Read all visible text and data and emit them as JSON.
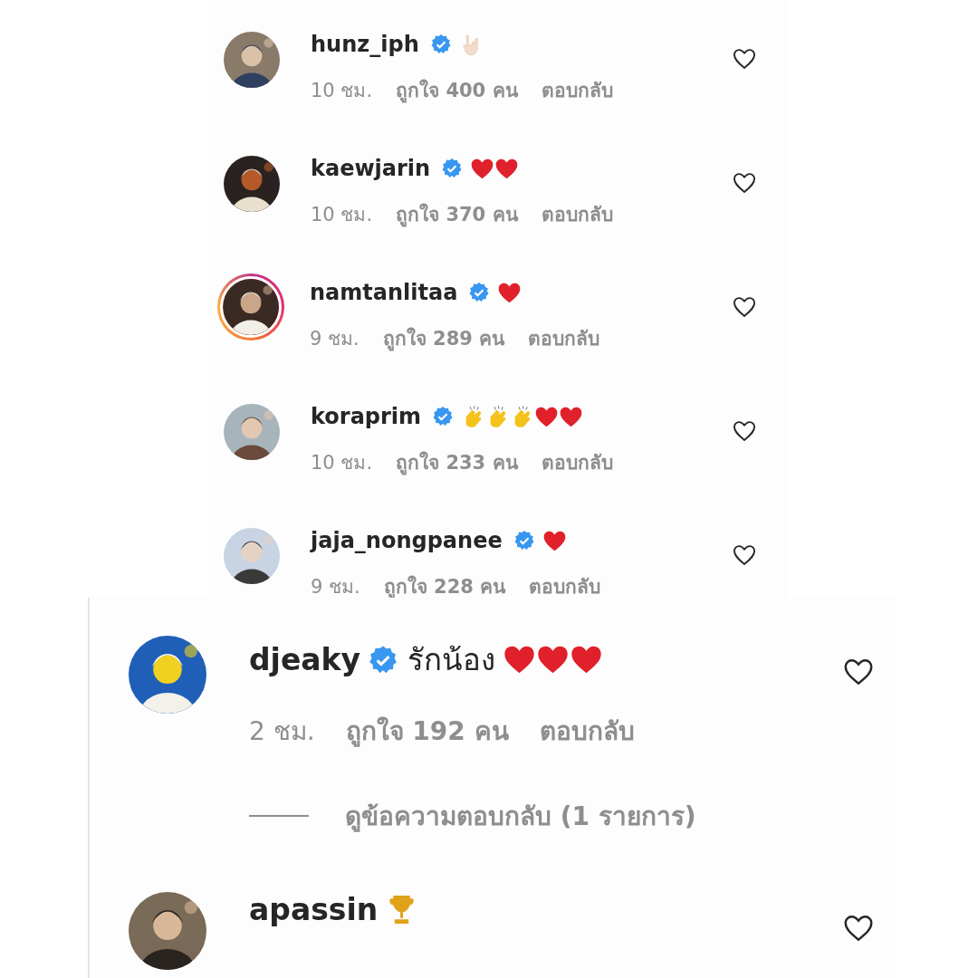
{
  "panels": [
    {
      "comments": [
        {
          "username": "hunz_iph",
          "verified": true,
          "story": false,
          "reactions": [
            {
              "kind": "horns"
            }
          ],
          "time": "10 ชม.",
          "likes": "ถูกใจ 400 คน",
          "reply": "ตอบกลับ"
        },
        {
          "username": "kaewjarin",
          "verified": true,
          "story": false,
          "reactions": [
            {
              "kind": "heart"
            },
            {
              "kind": "heart"
            }
          ],
          "time": "10 ชม.",
          "likes": "ถูกใจ 370 คน",
          "reply": "ตอบกลับ"
        },
        {
          "username": "namtanlitaa",
          "verified": true,
          "story": true,
          "reactions": [
            {
              "kind": "heart"
            }
          ],
          "time": "9 ชม.",
          "likes": "ถูกใจ 289 คน",
          "reply": "ตอบกลับ"
        },
        {
          "username": "koraprim",
          "verified": true,
          "story": false,
          "reactions": [
            {
              "kind": "clap"
            },
            {
              "kind": "clap"
            },
            {
              "kind": "clap"
            },
            {
              "kind": "heart"
            },
            {
              "kind": "heart"
            }
          ],
          "time": "10 ชม.",
          "likes": "ถูกใจ 233 คน",
          "reply": "ตอบกลับ"
        },
        {
          "username": "jaja_nongpanee",
          "verified": true,
          "story": false,
          "reactions": [
            {
              "kind": "heart"
            }
          ],
          "time": "9 ชม.",
          "likes": "ถูกใจ 228 คน",
          "reply": "ตอบกลับ"
        }
      ]
    },
    {
      "comments": [
        {
          "username": "djeaky",
          "verified": true,
          "story": false,
          "text": "รักน้อง",
          "reactions": [
            {
              "kind": "heart"
            },
            {
              "kind": "heart"
            },
            {
              "kind": "heart"
            }
          ],
          "time": "2 ชม.",
          "likes": "ถูกใจ 192 คน",
          "reply": "ตอบกลับ",
          "view_replies": "ดูข้อความตอบกลับ (1 รายการ)"
        },
        {
          "username": "apassin",
          "verified": false,
          "story": false,
          "reactions": [
            {
              "kind": "trophy"
            }
          ]
        }
      ]
    }
  ]
}
